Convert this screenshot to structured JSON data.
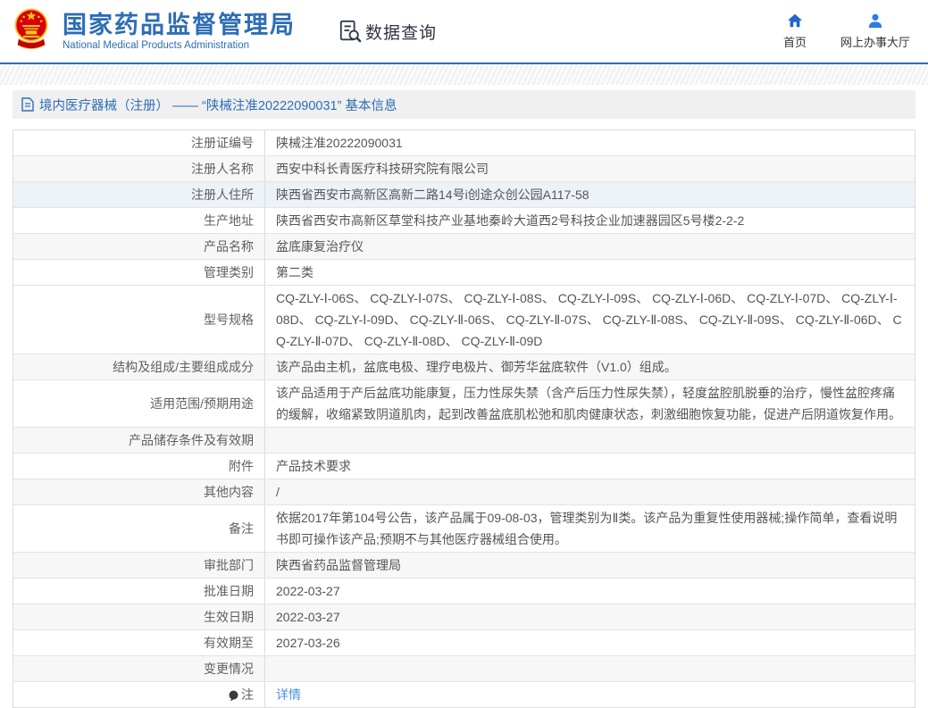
{
  "header": {
    "site_name_cn": "国家药品监督管理局",
    "site_name_en": "National Medical Products Administration",
    "section_title": "数据查询",
    "nav": [
      {
        "label": "首页"
      },
      {
        "label": "网上办事大厅"
      }
    ]
  },
  "breadcrumb": {
    "title": "境内医疗器械（注册） —— “陕械注准20222090031” 基本信息"
  },
  "table": {
    "rows": [
      {
        "label": "注册证编号",
        "value": "陕械注准20222090031"
      },
      {
        "label": "注册人名称",
        "value": "西安中科长青医疗科技研究院有限公司"
      },
      {
        "label": "注册人住所",
        "value": "陕西省西安市高新区高新二路14号i创途众创公园A117-58"
      },
      {
        "label": "生产地址",
        "value": "陕西省西安市高新区草堂科技产业基地秦岭大道西2号科技企业加速器园区5号楼2-2-2"
      },
      {
        "label": "产品名称",
        "value": "盆底康复治疗仪"
      },
      {
        "label": "管理类别",
        "value": "第二类"
      },
      {
        "label": "型号规格",
        "value": "CQ-ZLY-Ⅰ-06S、 CQ-ZLY-Ⅰ-07S、 CQ-ZLY-Ⅰ-08S、 CQ-ZLY-Ⅰ-09S、 CQ-ZLY-Ⅰ-06D、 CQ-ZLY-Ⅰ-07D、 CQ-ZLY-Ⅰ-08D、 CQ-ZLY-Ⅰ-09D、 CQ-ZLY-Ⅱ-06S、 CQ-ZLY-Ⅱ-07S、 CQ-ZLY-Ⅱ-08S、 CQ-ZLY-Ⅱ-09S、 CQ-ZLY-Ⅱ-06D、 CQ-ZLY-Ⅱ-07D、 CQ-ZLY-Ⅱ-08D、 CQ-ZLY-Ⅱ-09D"
      },
      {
        "label": "结构及组成/主要组成成分",
        "value": "该产品由主机，盆底电极、理疗电极片、御芳华盆底软件（V1.0）组成。"
      },
      {
        "label": "适用范围/预期用途",
        "value": "该产品适用于产后盆底功能康复，压力性尿失禁（含产后压力性尿失禁），轻度盆腔肌脱垂的治疗，慢性盆腔疼痛的缓解，收缩紧致阴道肌肉，起到改善盆底肌松弛和肌肉健康状态，刺激细胞恢复功能，促进产后阴道恢复作用。"
      },
      {
        "label": "产品储存条件及有效期",
        "value": ""
      },
      {
        "label": "附件",
        "value": "产品技术要求"
      },
      {
        "label": "其他内容",
        "value": "/"
      },
      {
        "label": "备注",
        "value": "依据2017年第104号公告，该产品属于09-08-03，管理类别为Ⅱ类。该产品为重复性使用器械;操作简单，查看说明书即可操作该产品;预期不与其他医疗器械组合使用。"
      },
      {
        "label": "审批部门",
        "value": "陕西省药品监督管理局"
      },
      {
        "label": "批准日期",
        "value": "2022-03-27"
      },
      {
        "label": "生效日期",
        "value": "2022-03-27"
      },
      {
        "label": "有效期至",
        "value": "2027-03-26"
      },
      {
        "label": "变更情况",
        "value": ""
      },
      {
        "label": "注",
        "value": "详情"
      }
    ]
  },
  "icons": {
    "national_emblem": "china-national-emblem",
    "data_query": "document-with-magnifier",
    "home": "house",
    "service_hall": "person",
    "breadcrumb_doc": "document",
    "note": "dark-balloon"
  },
  "colors": {
    "accent_blue": "#2d6db5",
    "link_blue": "#4a90e2",
    "emblem_red": "#d7000f",
    "emblem_gold": "#f5c31f",
    "row_alt": "#f7f7f7",
    "row_hover": "#edf1f8",
    "breadcrumb_bg": "#f0f0f0",
    "border": "#dcdcdc"
  }
}
